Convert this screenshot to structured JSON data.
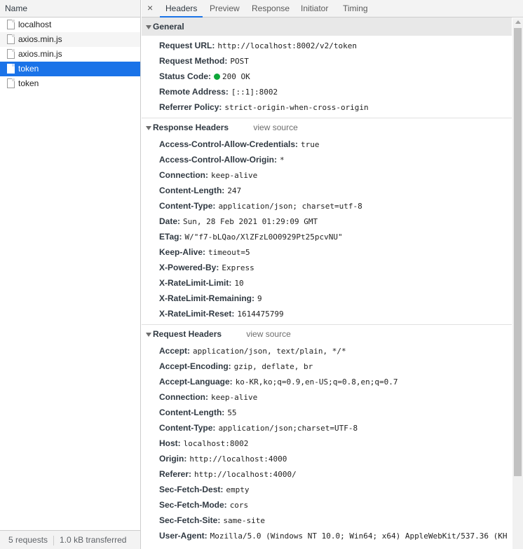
{
  "left": {
    "header": "Name",
    "requests": [
      {
        "name": "localhost"
      },
      {
        "name": "axios.min.js"
      },
      {
        "name": "axios.min.js"
      },
      {
        "name": "token",
        "selected": true
      },
      {
        "name": "token"
      }
    ],
    "status": {
      "requests": "5 requests",
      "transferred": "1.0 kB transferred"
    }
  },
  "tabs": [
    "Headers",
    "Preview",
    "Response",
    "Initiator",
    "Timing"
  ],
  "close_glyph": "×",
  "general": {
    "title": "General",
    "request_url": {
      "key": "Request URL:",
      "value": "http://localhost:8002/v2/token"
    },
    "request_method": {
      "key": "Request Method:",
      "value": "POST"
    },
    "status_code": {
      "key": "Status Code:",
      "value": "200 OK",
      "dot_color": "#0ea739"
    },
    "remote_address": {
      "key": "Remote Address:",
      "value": "[::1]:8002"
    },
    "referrer_policy": {
      "key": "Referrer Policy:",
      "value": "strict-origin-when-cross-origin"
    }
  },
  "response_headers": {
    "title": "Response Headers",
    "view_source": "view source",
    "items": [
      {
        "key": "Access-Control-Allow-Credentials:",
        "value": "true"
      },
      {
        "key": "Access-Control-Allow-Origin:",
        "value": "*"
      },
      {
        "key": "Connection:",
        "value": "keep-alive"
      },
      {
        "key": "Content-Length:",
        "value": "247"
      },
      {
        "key": "Content-Type:",
        "value": "application/json; charset=utf-8"
      },
      {
        "key": "Date:",
        "value": "Sun, 28 Feb 2021 01:29:09 GMT"
      },
      {
        "key": "ETag:",
        "value": "W/\"f7-bLQao/XlZFzL0O0929Pt25pcvNU\""
      },
      {
        "key": "Keep-Alive:",
        "value": "timeout=5"
      },
      {
        "key": "X-Powered-By:",
        "value": "Express"
      },
      {
        "key": "X-RateLimit-Limit:",
        "value": "10"
      },
      {
        "key": "X-RateLimit-Remaining:",
        "value": "9"
      },
      {
        "key": "X-RateLimit-Reset:",
        "value": "1614475799"
      }
    ]
  },
  "request_headers": {
    "title": "Request Headers",
    "view_source": "view source",
    "items": [
      {
        "key": "Accept:",
        "value": "application/json, text/plain, */*"
      },
      {
        "key": "Accept-Encoding:",
        "value": "gzip, deflate, br"
      },
      {
        "key": "Accept-Language:",
        "value": "ko-KR,ko;q=0.9,en-US;q=0.8,en;q=0.7"
      },
      {
        "key": "Connection:",
        "value": "keep-alive"
      },
      {
        "key": "Content-Length:",
        "value": "55"
      },
      {
        "key": "Content-Type:",
        "value": "application/json;charset=UTF-8"
      },
      {
        "key": "Host:",
        "value": "localhost:8002"
      },
      {
        "key": "Origin:",
        "value": "http://localhost:4000"
      },
      {
        "key": "Referer:",
        "value": "http://localhost:4000/"
      },
      {
        "key": "Sec-Fetch-Dest:",
        "value": "empty"
      },
      {
        "key": "Sec-Fetch-Mode:",
        "value": "cors"
      },
      {
        "key": "Sec-Fetch-Site:",
        "value": "same-site"
      },
      {
        "key": "User-Agent:",
        "value": "Mozilla/5.0 (Windows NT 10.0; Win64; x64) AppleWebKit/537.36 (KH"
      }
    ]
  },
  "colors": {
    "accent": "#1a73e8",
    "status_ok": "#0ea739"
  }
}
